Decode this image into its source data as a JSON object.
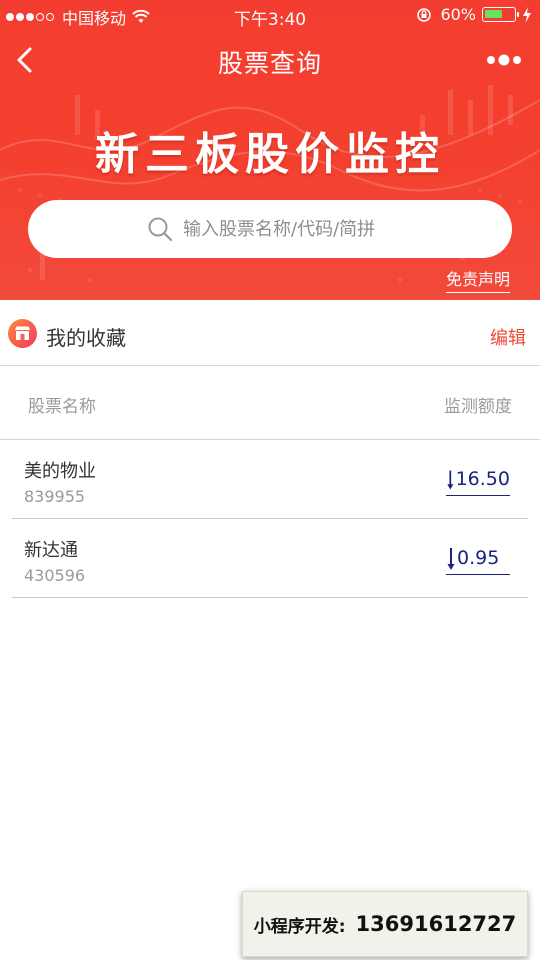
{
  "status_bar": {
    "carrier": "中国移动",
    "time": "下午3:40",
    "battery": "60%",
    "battery_level": 0.6
  },
  "nav": {
    "title": "股票查询"
  },
  "banner": {
    "title": "新三板股价监控"
  },
  "search": {
    "placeholder": "输入股票名称/代码/简拼"
  },
  "disclaimer_label": "免责声明",
  "favorites": {
    "title": "我的收藏",
    "edit_label": "编辑"
  },
  "columns": {
    "name": "股票名称",
    "amount": "监测额度"
  },
  "stocks": [
    {
      "name": "美的物业",
      "code": "839955",
      "amount": "16.50"
    },
    {
      "name": "新达通",
      "code": "430596",
      "amount": "0.95"
    }
  ],
  "ad": {
    "label": "小程序开发:",
    "phone": "13691612727"
  },
  "colors": {
    "header_red": "#f4402f",
    "edit_red": "#f04a34",
    "amount_blue": "#1a237e"
  }
}
